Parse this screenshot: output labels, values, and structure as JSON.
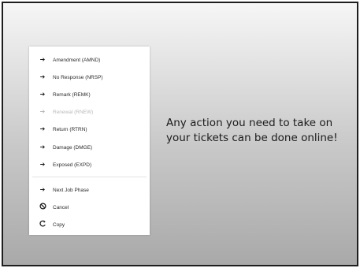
{
  "menu": {
    "items": [
      {
        "label": "Amendment (AMND)",
        "icon": "arrow-right-icon",
        "glyph": "➔",
        "disabled": false
      },
      {
        "label": "No Response (NRSP)",
        "icon": "arrow-right-icon",
        "glyph": "➔",
        "disabled": false
      },
      {
        "label": "Remark (REMK)",
        "icon": "arrow-right-icon",
        "glyph": "➔",
        "disabled": false
      },
      {
        "label": "Renewal (RNEW)",
        "icon": "arrow-right-icon",
        "glyph": "➔",
        "disabled": true
      },
      {
        "label": "Return (RTRN)",
        "icon": "arrow-right-icon",
        "glyph": "➔",
        "disabled": false
      },
      {
        "label": "Damage (DMGE)",
        "icon": "arrow-right-icon",
        "glyph": "➔",
        "disabled": false
      },
      {
        "label": "Exposed (EXPD)",
        "icon": "arrow-right-icon",
        "glyph": "➔",
        "disabled": false
      },
      {
        "label": "Next Job Phase",
        "icon": "arrow-right-icon",
        "glyph": "➔",
        "disabled": false
      },
      {
        "label": "Cancel",
        "icon": "cancel-icon",
        "glyph": "⃠",
        "disabled": false
      },
      {
        "label": "Copy",
        "icon": "copy-icon",
        "glyph": "C",
        "disabled": false
      }
    ]
  },
  "message": {
    "line1": "Any action you need to take on",
    "line2": "your tickets can be done online!"
  },
  "colors": {
    "frame_border": "#1e1e1e",
    "background_top": "#f6f6f6",
    "background_bottom": "#a9a9a9",
    "menu_bg": "#ffffff",
    "disabled_text": "#b9b9b9"
  }
}
